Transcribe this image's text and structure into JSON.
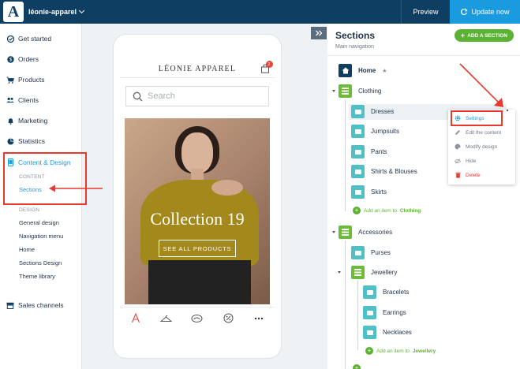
{
  "topbar": {
    "logo_letter": "A",
    "store_name": "léonie-apparel",
    "preview_label": "Preview",
    "update_label": "Update now"
  },
  "sidebar": {
    "items": [
      {
        "label": "Get started",
        "icon": "check-circle-icon"
      },
      {
        "label": "Orders",
        "icon": "dollar-icon"
      },
      {
        "label": "Products",
        "icon": "cart-icon"
      },
      {
        "label": "Clients",
        "icon": "users-icon"
      },
      {
        "label": "Marketing",
        "icon": "bell-icon"
      },
      {
        "label": "Statistics",
        "icon": "pie-icon"
      },
      {
        "label": "Content & Design",
        "icon": "phone-icon"
      },
      {
        "label": "Sales channels",
        "icon": "store-icon"
      }
    ],
    "content_label": "CONTENT",
    "sections_label": "Sections",
    "design_label": "DESIGN",
    "design_items": [
      "General design",
      "Navigation menu",
      "Home",
      "Sections Design",
      "Theme library"
    ]
  },
  "phone": {
    "brand": "LÉONIE APPAREL",
    "cart_count": "2",
    "search_placeholder": "Search",
    "hero_title": "Collection 19",
    "hero_button": "SEE ALL PRODUCTS"
  },
  "panel": {
    "title": "Sections",
    "subtitle": "Main navigation",
    "add_section_label": "ADD A SECTION",
    "home_label": "Home",
    "clothing": {
      "label": "Clothing",
      "children": [
        "Dresses",
        "Jumpsuits",
        "Pants",
        "Shirts & Blouses",
        "Skirts"
      ],
      "add_prefix": "Add an item to",
      "add_target": "Clothing"
    },
    "accessories": {
      "label": "Accessories",
      "children": [
        "Purses"
      ],
      "jewellery": {
        "label": "Jewellery",
        "children": [
          "Bracelets",
          "Earrings",
          "Necklaces"
        ],
        "add_prefix": "Add an item to",
        "add_target": "Jewellery"
      }
    }
  },
  "context_menu": {
    "items": [
      {
        "label": "Settings",
        "icon": "gear-icon"
      },
      {
        "label": "Edit the content",
        "icon": "pencil-icon"
      },
      {
        "label": "Modify design",
        "icon": "palette-icon"
      },
      {
        "label": "Hide",
        "icon": "eye-off-icon"
      },
      {
        "label": "Delete",
        "icon": "trash-icon"
      }
    ]
  },
  "colors": {
    "topbar": "#0e3e62",
    "accent": "#1a9be0",
    "green": "#5cb233",
    "annotation_red": "#e53a2d"
  }
}
